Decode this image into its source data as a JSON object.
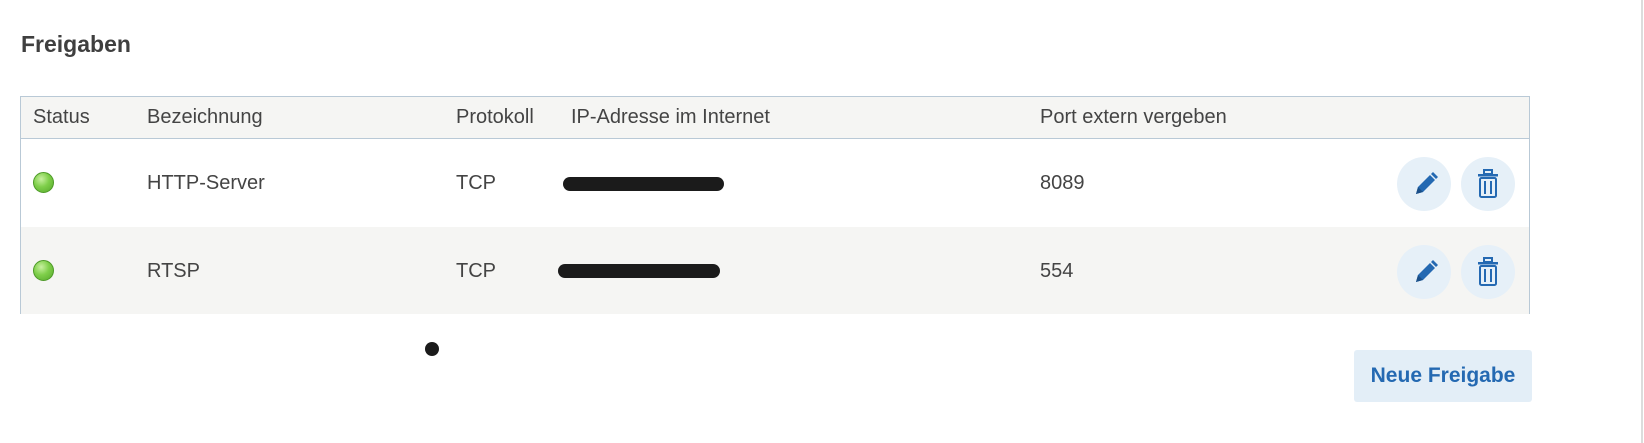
{
  "section": {
    "title": "Freigaben"
  },
  "table": {
    "columns": {
      "status": "Status",
      "name": "Bezeichnung",
      "protocol": "Protokoll",
      "ip": "IP-Adresse im Internet",
      "port": "Port extern vergeben"
    },
    "rows": [
      {
        "status": "active",
        "status_color": "#7fcf4a",
        "name": "HTTP-Server",
        "protocol": "TCP",
        "ip": "",
        "ip_redacted": true,
        "port": "8089"
      },
      {
        "status": "active",
        "status_color": "#7fcf4a",
        "name": "RTSP",
        "protocol": "TCP",
        "ip": "",
        "ip_redacted": true,
        "port": "554"
      }
    ],
    "row_actions": {
      "edit_icon": "pencil-icon",
      "delete_icon": "trash-icon"
    }
  },
  "actions": {
    "new_label": "Neue Freigabe"
  },
  "colors": {
    "accent": "#2469b2",
    "button_bg": "#e3eef7",
    "header_bg": "#f5f5f3",
    "border": "#b9c9d6"
  }
}
